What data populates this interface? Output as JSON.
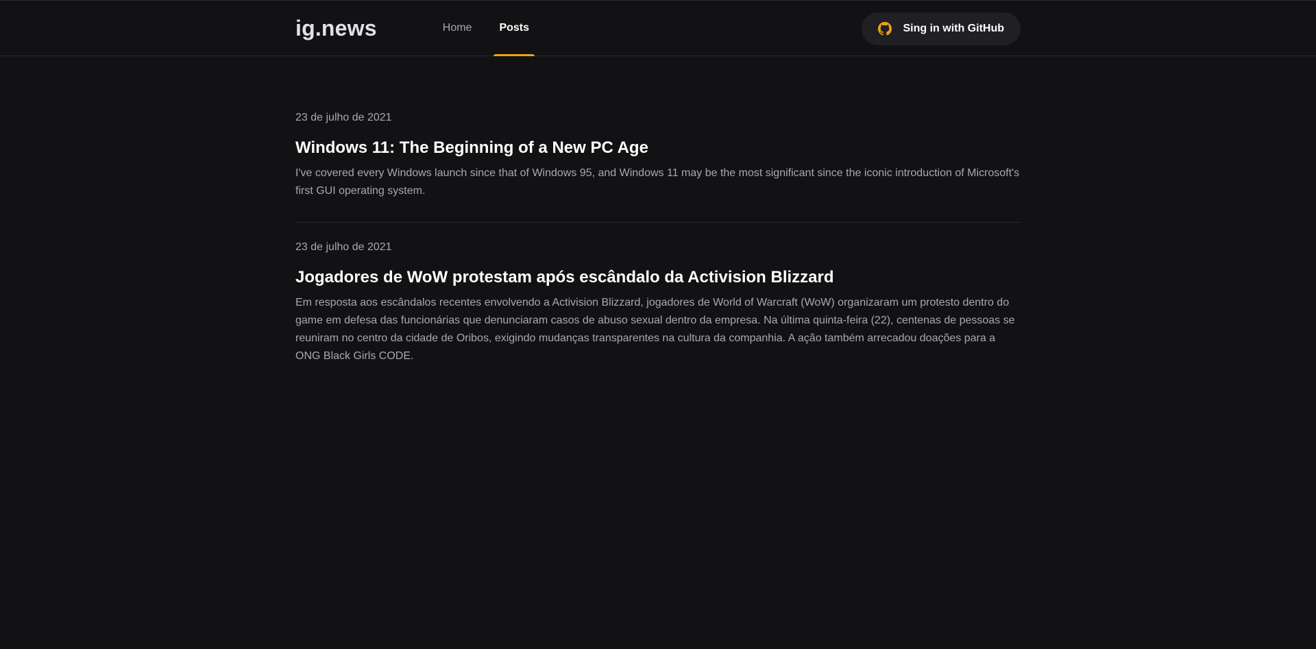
{
  "header": {
    "logo": "ig.news",
    "nav": [
      {
        "label": "Home",
        "active": false
      },
      {
        "label": "Posts",
        "active": true
      }
    ],
    "signin_label": "Sing in with GitHub",
    "signin_icon": "github-icon",
    "accent_color": "#eba417"
  },
  "posts": [
    {
      "date": "23 de julho de 2021",
      "title": "Windows 11: The Beginning of a New PC Age",
      "excerpt": "I've covered every Windows launch since that of Windows 95, and Windows 11 may be the most significant since the iconic introduction of Microsoft's first GUI operating system."
    },
    {
      "date": "23 de julho de 2021",
      "title": "Jogadores de WoW protestam após escândalo da Activision Blizzard",
      "excerpt": "Em resposta aos escândalos recentes envolvendo a Activision Blizzard, jogadores de World of Warcraft (WoW) organizaram um protesto dentro do game em defesa das funcionárias que denunciaram casos de abuso sexual dentro da empresa. Na última quinta-feira (22), centenas de pessoas se reuniram no centro da cidade de Oribos, exigindo mudanças transparentes na cultura da companhia. A ação também arrecadou doações para a ONG Black Girls CODE."
    }
  ]
}
